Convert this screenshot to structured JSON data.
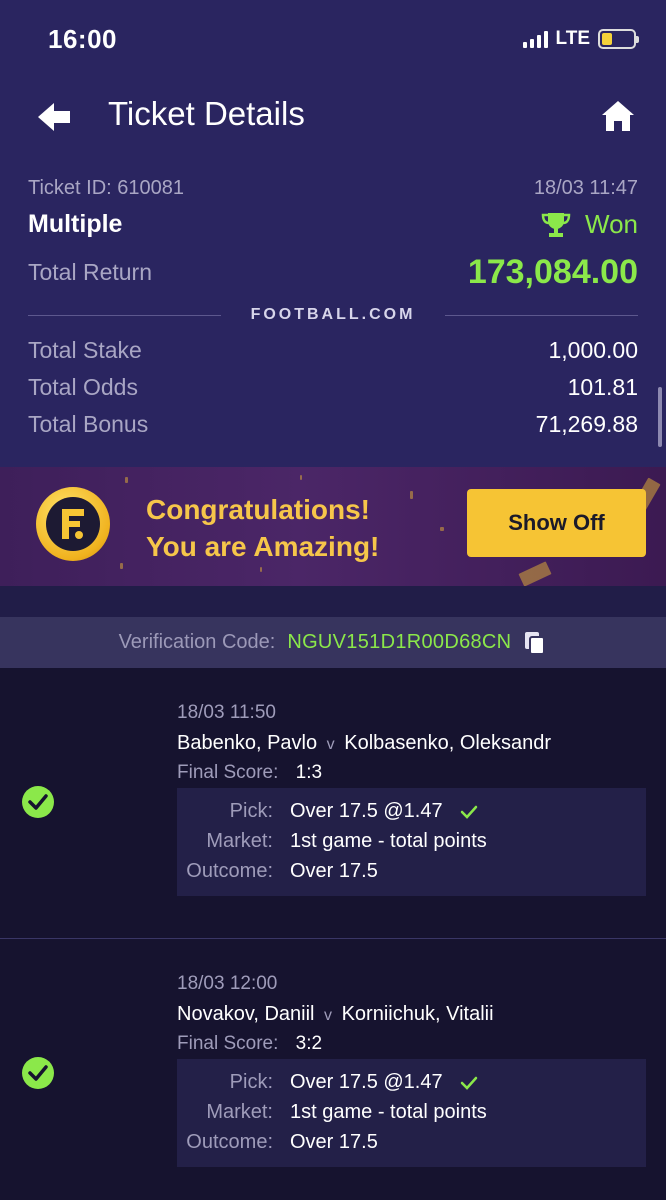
{
  "status": {
    "time": "16:00",
    "network": "LTE"
  },
  "header": {
    "title": "Ticket Details"
  },
  "ticket": {
    "id_label": "Ticket ID: 610081",
    "datetime": "18/03 11:47",
    "type": "Multiple",
    "status": "Won",
    "total_return_label": "Total Return",
    "total_return": "173,084.00",
    "brand": "FOOTBALL.COM",
    "total_stake_label": "Total Stake",
    "total_stake": "1,000.00",
    "total_odds_label": "Total Odds",
    "total_odds": "101.81",
    "total_bonus_label": "Total Bonus",
    "total_bonus": "71,269.88"
  },
  "banner": {
    "line1": "Congratulations!",
    "line2": "You are Amazing!",
    "button": "Show Off"
  },
  "verification": {
    "label": "Verification Code:",
    "code": "NGUV151D1R00D68CN"
  },
  "selections": [
    {
      "datetime": "18/03 11:50",
      "home": "Babenko, Pavlo",
      "vs": "v",
      "away": "Kolbasenko, Oleksandr",
      "score_label": "Final Score:",
      "score": "1:3",
      "pick_label": "Pick:",
      "pick": "Over 17.5 @1.47",
      "market_label": "Market:",
      "market": "1st game - total points",
      "outcome_label": "Outcome:",
      "outcome": "Over 17.5"
    },
    {
      "datetime": "18/03 12:00",
      "home": "Novakov, Daniil",
      "vs": "v",
      "away": "Korniichuk, Vitalii",
      "score_label": "Final Score:",
      "score": "3:2",
      "pick_label": "Pick:",
      "pick": "Over 17.5 @1.47",
      "market_label": "Market:",
      "market": "1st game - total points",
      "outcome_label": "Outcome:",
      "outcome": "Over 17.5"
    }
  ],
  "colors": {
    "accent_green": "#8be84a",
    "header_bg": "#2a2560",
    "page_bg": "#16132f",
    "button_yellow": "#f6c434"
  }
}
